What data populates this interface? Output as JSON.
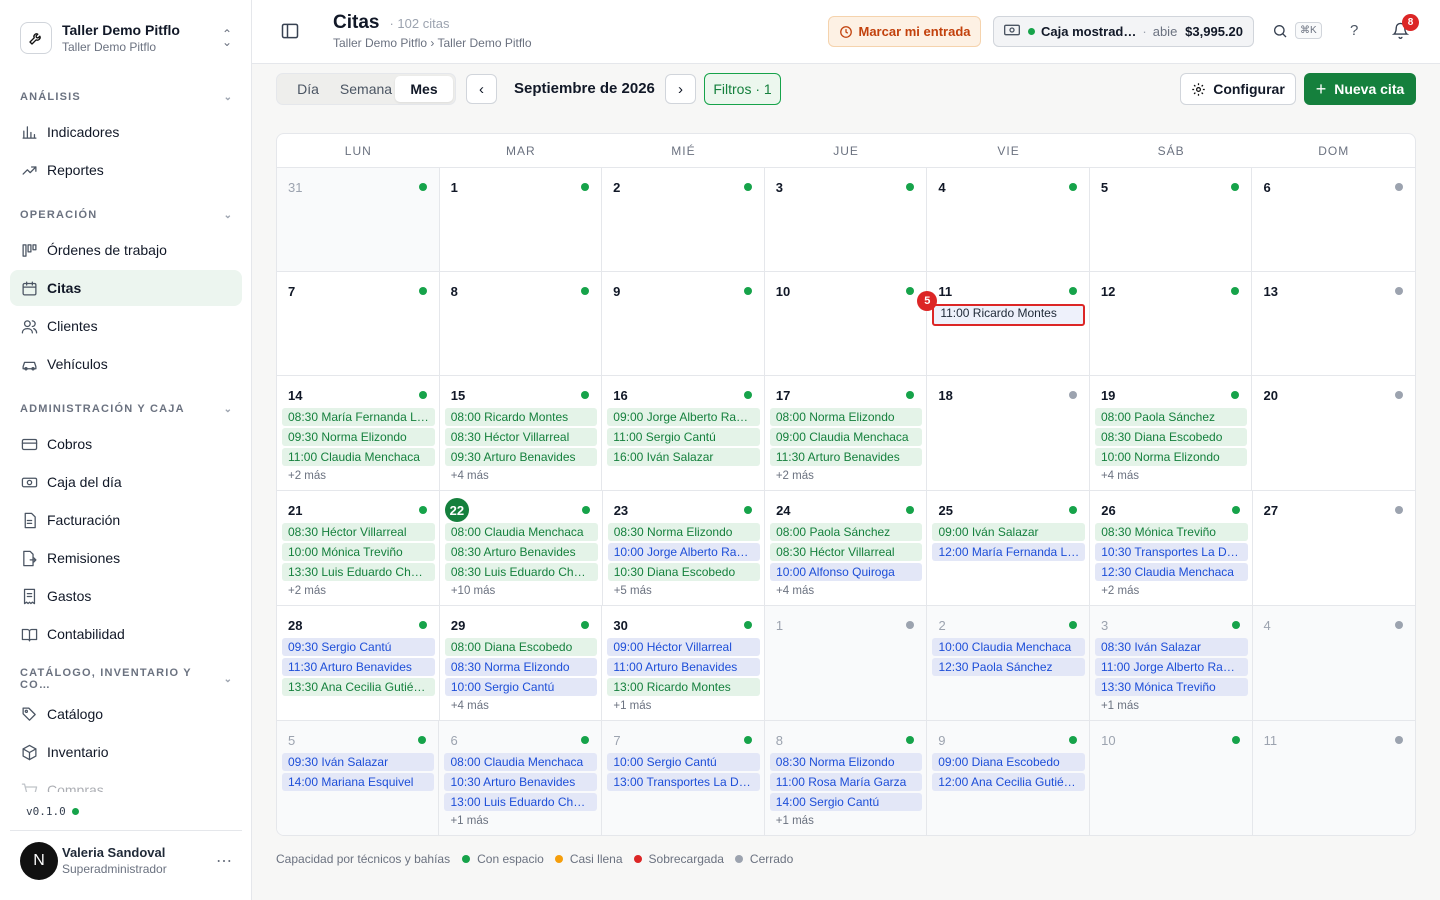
{
  "workspace": {
    "name": "Taller Demo Pitflo",
    "sub": "Taller Demo Pitflo"
  },
  "sidebar": {
    "sections": [
      {
        "label": "ANÁLISIS",
        "items": [
          {
            "label": "Indicadores",
            "icon": "bar-chart-icon"
          },
          {
            "label": "Reportes",
            "icon": "trend-icon"
          }
        ]
      },
      {
        "label": "OPERACIÓN",
        "items": [
          {
            "label": "Órdenes de trabajo",
            "icon": "kanban-icon"
          },
          {
            "label": "Citas",
            "icon": "calendar-icon",
            "active": true
          },
          {
            "label": "Clientes",
            "icon": "users-icon"
          },
          {
            "label": "Vehículos",
            "icon": "car-icon"
          }
        ]
      },
      {
        "label": "ADMINISTRACIÓN Y CAJA",
        "items": [
          {
            "label": "Cobros",
            "icon": "card-icon"
          },
          {
            "label": "Caja del día",
            "icon": "cash-icon"
          },
          {
            "label": "Facturación",
            "icon": "invoice-icon"
          },
          {
            "label": "Remisiones",
            "icon": "remision-icon"
          },
          {
            "label": "Gastos",
            "icon": "receipt-icon"
          },
          {
            "label": "Contabilidad",
            "icon": "book-icon"
          }
        ]
      },
      {
        "label": "CATÁLOGO, INVENTARIO Y CO…",
        "items": [
          {
            "label": "Catálogo",
            "icon": "tag-icon"
          },
          {
            "label": "Inventario",
            "icon": "box-icon"
          },
          {
            "label": "Compras",
            "icon": "cart-icon",
            "faded": true
          }
        ]
      }
    ],
    "version": "v0.1.0",
    "user": {
      "initial": "N",
      "name": "Valeria Sandoval",
      "role": "Superadministrador"
    }
  },
  "header": {
    "title": "Citas",
    "count": "102 citas",
    "breadcrumb": "Taller Demo Pitflo › Taller Demo Pitflo",
    "entrada_label": "Marcar mi entrada",
    "caja": {
      "name": "Caja mostrad…",
      "status": "abie",
      "amount": "$3,995.20"
    },
    "kbd": "⌘K",
    "help": "?",
    "notifications": "8"
  },
  "toolbar": {
    "views": [
      "Día",
      "Semana",
      "Mes"
    ],
    "active_view": "Mes",
    "prev": "‹",
    "next": "›",
    "month": "Septiembre de 2026",
    "filters": "Filtros · 1",
    "config": "Configurar",
    "new": "Nueva cita"
  },
  "calendar": {
    "weekdays": [
      "LUN",
      "MAR",
      "MIÉ",
      "JUE",
      "VIE",
      "SÁB",
      "DOM"
    ],
    "weeks": [
      [
        {
          "d": "31",
          "m": true,
          "c": "g"
        },
        {
          "d": "1",
          "c": "g"
        },
        {
          "d": "2",
          "c": "g"
        },
        {
          "d": "3",
          "c": "g"
        },
        {
          "d": "4",
          "c": "g"
        },
        {
          "d": "5",
          "c": "g"
        },
        {
          "d": "6",
          "c": "x"
        }
      ],
      [
        {
          "d": "7",
          "c": "g"
        },
        {
          "d": "8",
          "c": "g"
        },
        {
          "d": "9",
          "c": "g"
        },
        {
          "d": "10",
          "c": "g"
        },
        {
          "d": "11",
          "c": "g",
          "sel_badge": "5",
          "ev": [
            [
              "11:00 Ricardo Montes",
              "sel"
            ]
          ]
        },
        {
          "d": "12",
          "c": "g"
        },
        {
          "d": "13",
          "c": "x"
        }
      ],
      [
        {
          "d": "14",
          "c": "g",
          "ev": [
            [
              "08:30 María Fernanda L…",
              "g"
            ],
            [
              "09:30 Norma Elizondo",
              "g"
            ],
            [
              "11:00 Claudia Menchaca",
              "g"
            ]
          ],
          "more": "+2 más"
        },
        {
          "d": "15",
          "c": "g",
          "ev": [
            [
              "08:00 Ricardo Montes",
              "g"
            ],
            [
              "08:30 Héctor Villarreal",
              "g"
            ],
            [
              "09:30 Arturo Benavides",
              "g"
            ]
          ],
          "more": "+4 más"
        },
        {
          "d": "16",
          "c": "g",
          "ev": [
            [
              "09:00 Jorge Alberto Ra…",
              "g"
            ],
            [
              "11:00 Sergio Cantú",
              "g"
            ],
            [
              "16:00 Iván Salazar",
              "g"
            ]
          ]
        },
        {
          "d": "17",
          "c": "g",
          "ev": [
            [
              "08:00 Norma Elizondo",
              "g"
            ],
            [
              "09:00 Claudia Menchaca",
              "g"
            ],
            [
              "11:30 Arturo Benavides",
              "g"
            ]
          ],
          "more": "+2 más"
        },
        {
          "d": "18",
          "c": "x"
        },
        {
          "d": "19",
          "c": "g",
          "ev": [
            [
              "08:00 Paola Sánchez",
              "g"
            ],
            [
              "08:30 Diana Escobedo",
              "g"
            ],
            [
              "10:00 Norma Elizondo",
              "g"
            ]
          ],
          "more": "+4 más"
        },
        {
          "d": "20",
          "c": "x"
        }
      ],
      [
        {
          "d": "21",
          "c": "g",
          "ev": [
            [
              "08:30 Héctor Villarreal",
              "g"
            ],
            [
              "10:00 Mónica Treviño",
              "g"
            ],
            [
              "13:30 Luis Eduardo Chá…",
              "g"
            ]
          ],
          "more": "+2 más"
        },
        {
          "d": "22",
          "today": true,
          "c": "g",
          "ev": [
            [
              "08:00 Claudia Menchaca",
              "g"
            ],
            [
              "08:30 Arturo Benavides",
              "g"
            ],
            [
              "08:30 Luis Eduardo Chá…",
              "g"
            ]
          ],
          "more": "+10 más"
        },
        {
          "d": "23",
          "c": "g",
          "ev": [
            [
              "08:30 Norma Elizondo",
              "g"
            ],
            [
              "10:00 Jorge Alberto Ra…",
              "b"
            ],
            [
              "10:30 Diana Escobedo",
              "g"
            ]
          ],
          "more": "+5 más"
        },
        {
          "d": "24",
          "c": "g",
          "ev": [
            [
              "08:00 Paola Sánchez",
              "g"
            ],
            [
              "08:30 Héctor Villarreal",
              "g"
            ],
            [
              "10:00 Alfonso Quiroga",
              "b"
            ]
          ],
          "more": "+4 más"
        },
        {
          "d": "25",
          "c": "g",
          "ev": [
            [
              "09:00 Iván Salazar",
              "g"
            ],
            [
              "12:00 María Fernanda L…",
              "b"
            ]
          ]
        },
        {
          "d": "26",
          "c": "g",
          "ev": [
            [
              "08:30 Mónica Treviño",
              "g"
            ],
            [
              "10:30 Transportes La D…",
              "b"
            ],
            [
              "12:30 Claudia Menchaca",
              "b"
            ]
          ],
          "more": "+2 más"
        },
        {
          "d": "27",
          "c": "x"
        }
      ],
      [
        {
          "d": "28",
          "c": "g",
          "ev": [
            [
              "09:30 Sergio Cantú",
              "b"
            ],
            [
              "11:30 Arturo Benavides",
              "b"
            ],
            [
              "13:30 Ana Cecilia Gutiér…",
              "g"
            ]
          ]
        },
        {
          "d": "29",
          "c": "g",
          "ev": [
            [
              "08:00 Diana Escobedo",
              "g"
            ],
            [
              "08:30 Norma Elizondo",
              "b"
            ],
            [
              "10:00 Sergio Cantú",
              "b"
            ]
          ],
          "more": "+4 más"
        },
        {
          "d": "30",
          "c": "g",
          "ev": [
            [
              "09:00 Héctor Villarreal",
              "b"
            ],
            [
              "11:00 Arturo Benavides",
              "b"
            ],
            [
              "13:00 Ricardo Montes",
              "g"
            ]
          ],
          "more": "+1 más"
        },
        {
          "d": "1",
          "m": true,
          "c": "x"
        },
        {
          "d": "2",
          "m": true,
          "c": "g",
          "ev": [
            [
              "10:00 Claudia Menchaca",
              "b"
            ],
            [
              "12:30 Paola Sánchez",
              "b"
            ]
          ]
        },
        {
          "d": "3",
          "m": true,
          "c": "g",
          "ev": [
            [
              "08:30 Iván Salazar",
              "b"
            ],
            [
              "11:00 Jorge Alberto Ra…",
              "b"
            ],
            [
              "13:30 Mónica Treviño",
              "b"
            ]
          ],
          "more": "+1 más"
        },
        {
          "d": "4",
          "m": true,
          "c": "x"
        }
      ],
      [
        {
          "d": "5",
          "m": true,
          "c": "g",
          "ev": [
            [
              "09:30 Iván Salazar",
              "b"
            ],
            [
              "14:00 Mariana Esquivel",
              "b"
            ]
          ]
        },
        {
          "d": "6",
          "m": true,
          "c": "g",
          "ev": [
            [
              "08:00 Claudia Menchaca",
              "b"
            ],
            [
              "10:30 Arturo Benavides",
              "b"
            ],
            [
              "13:00 Luis Eduardo Chá…",
              "b"
            ]
          ],
          "more": "+1 más"
        },
        {
          "d": "7",
          "m": true,
          "c": "g",
          "ev": [
            [
              "10:00 Sergio Cantú",
              "b"
            ],
            [
              "13:00 Transportes La D…",
              "b"
            ]
          ]
        },
        {
          "d": "8",
          "m": true,
          "c": "g",
          "ev": [
            [
              "08:30 Norma Elizondo",
              "b"
            ],
            [
              "11:00 Rosa María Garza",
              "b"
            ],
            [
              "14:00 Sergio Cantú",
              "b"
            ]
          ],
          "more": "+1 más"
        },
        {
          "d": "9",
          "m": true,
          "c": "g",
          "ev": [
            [
              "09:00 Diana Escobedo",
              "b"
            ],
            [
              "12:00 Ana Cecilia Gutiér…",
              "b"
            ]
          ]
        },
        {
          "d": "10",
          "m": true,
          "c": "g"
        },
        {
          "d": "11",
          "m": true,
          "c": "x"
        }
      ]
    ]
  },
  "legend": {
    "title": "Capacidad por técnicos y bahías",
    "items": [
      {
        "label": "Con espacio",
        "color": "#16a34a"
      },
      {
        "label": "Casi llena",
        "color": "#f59e0b"
      },
      {
        "label": "Sobrecargada",
        "color": "#dc2626"
      },
      {
        "label": "Cerrado",
        "color": "#9ca3af"
      }
    ]
  }
}
